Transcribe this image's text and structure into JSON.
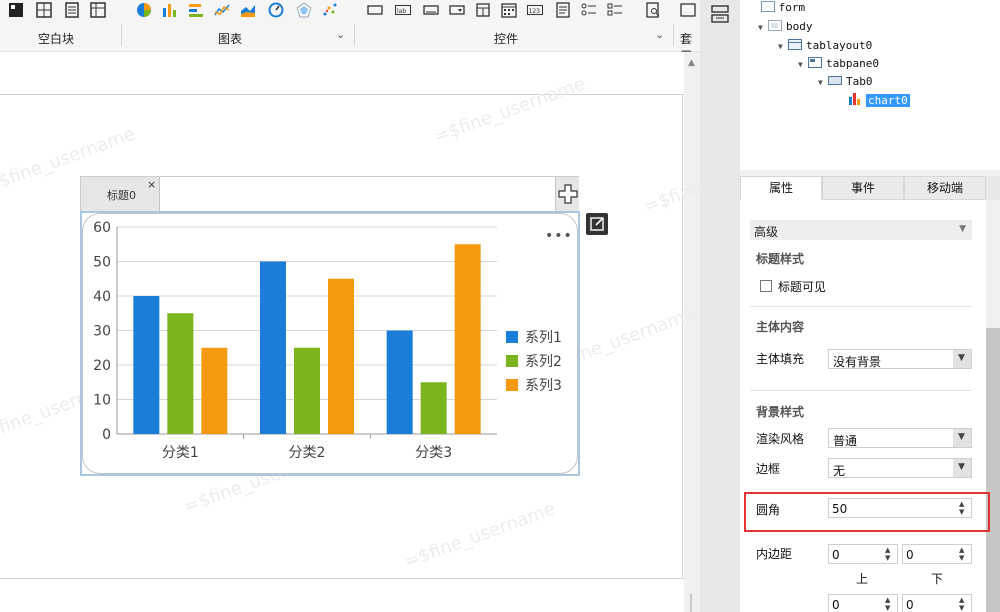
{
  "ribbon": {
    "groups": [
      {
        "label": "空白块"
      },
      {
        "label": "图表"
      },
      {
        "label": "控件"
      },
      {
        "label": "套用"
      }
    ]
  },
  "canvas": {
    "watermark": "=$fine_username",
    "tab_label": "标题0",
    "tab_close": "×",
    "add_tab": "+",
    "more": "•••"
  },
  "chart_data": {
    "type": "bar",
    "categories": [
      "分类1",
      "分类2",
      "分类3"
    ],
    "series": [
      {
        "name": "系列1",
        "values": [
          40,
          50,
          30
        ],
        "color": "#1a7ed8"
      },
      {
        "name": "系列2",
        "values": [
          35,
          25,
          15
        ],
        "color": "#7ab51d"
      },
      {
        "name": "系列3",
        "values": [
          25,
          45,
          55
        ],
        "color": "#f59a0f"
      }
    ],
    "ylim": [
      0,
      60
    ],
    "yticks": [
      0,
      10,
      20,
      30,
      40,
      50,
      60
    ],
    "grid": true,
    "legend": "right"
  },
  "tree": {
    "nodes": [
      {
        "label": "form"
      },
      {
        "label": "body"
      },
      {
        "label": "tablayout0"
      },
      {
        "label": "tabpane0"
      },
      {
        "label": "Tab0"
      },
      {
        "label": "chart0",
        "selected": true
      }
    ]
  },
  "panel": {
    "tabs": [
      {
        "label": "属性",
        "active": true
      },
      {
        "label": "事件"
      },
      {
        "label": "移动端"
      }
    ],
    "advanced": "高级",
    "title_style": "标题样式",
    "title_visible": "标题可见",
    "body_content": "主体内容",
    "body_fill": {
      "label": "主体填充",
      "value": "没有背景"
    },
    "bg_style": "背景样式",
    "render_style": {
      "label": "渲染风格",
      "value": "普通"
    },
    "border": {
      "label": "边框",
      "value": "无"
    },
    "corner": {
      "label": "圆角",
      "value": "50"
    },
    "padding": {
      "label": "内边距",
      "top": "0",
      "bottom": "0",
      "top_label": "上",
      "bottom_label": "下",
      "left": "0",
      "right": "0"
    }
  }
}
